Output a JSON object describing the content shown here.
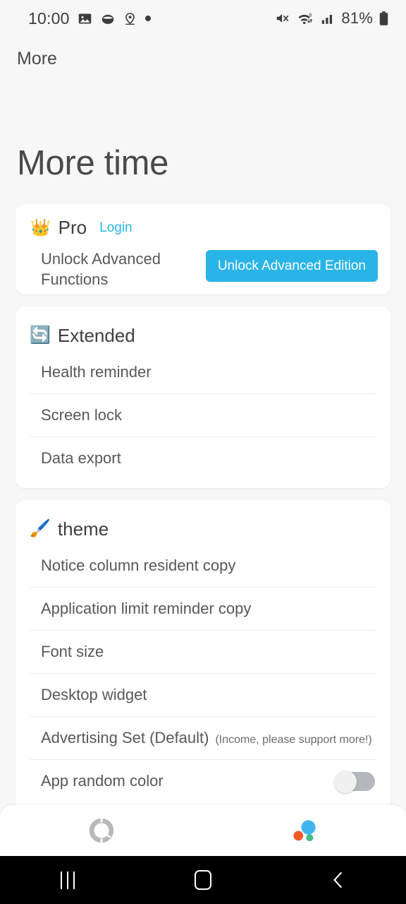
{
  "status_bar": {
    "time": "10:00",
    "left_icons": [
      "image-icon",
      "shell-icon",
      "location-pin-icon",
      "dot-icon"
    ],
    "battery_text": "81%",
    "right_icons": [
      "mute-vibrate-icon",
      "wifi-6-icon",
      "cellular-signal-icon",
      "battery-icon"
    ]
  },
  "toolbar": {
    "title": "More"
  },
  "header": {
    "title": "More time"
  },
  "pro_card": {
    "emoji": "👑",
    "title": "Pro",
    "login_label": "Login",
    "description": "Unlock Advanced Functions",
    "button_label": "Unlock Advanced Edition",
    "accent_color": "#29b4e8"
  },
  "extended_card": {
    "emoji": "🔄",
    "title": "Extended",
    "rows": [
      {
        "label": "Health reminder"
      },
      {
        "label": "Screen lock"
      },
      {
        "label": "Data export"
      }
    ]
  },
  "theme_card": {
    "emoji": "🖌️",
    "title": "theme",
    "rows": [
      {
        "label": "Notice column resident copy"
      },
      {
        "label": "Application limit reminder copy"
      },
      {
        "label": "Font size"
      },
      {
        "label": "Desktop widget"
      },
      {
        "label": "Advertising Set (Default)",
        "sub": "(Income, please support more!)"
      },
      {
        "label": "App random color",
        "toggle": "off"
      }
    ]
  },
  "bottom_nav": {
    "items": [
      {
        "icon": "donut-chart-icon",
        "state": "inactive"
      },
      {
        "icon": "bubble-cluster-icon",
        "state": "active"
      }
    ]
  },
  "system_nav": {
    "buttons": [
      "recents-icon",
      "home-icon",
      "back-icon"
    ]
  }
}
